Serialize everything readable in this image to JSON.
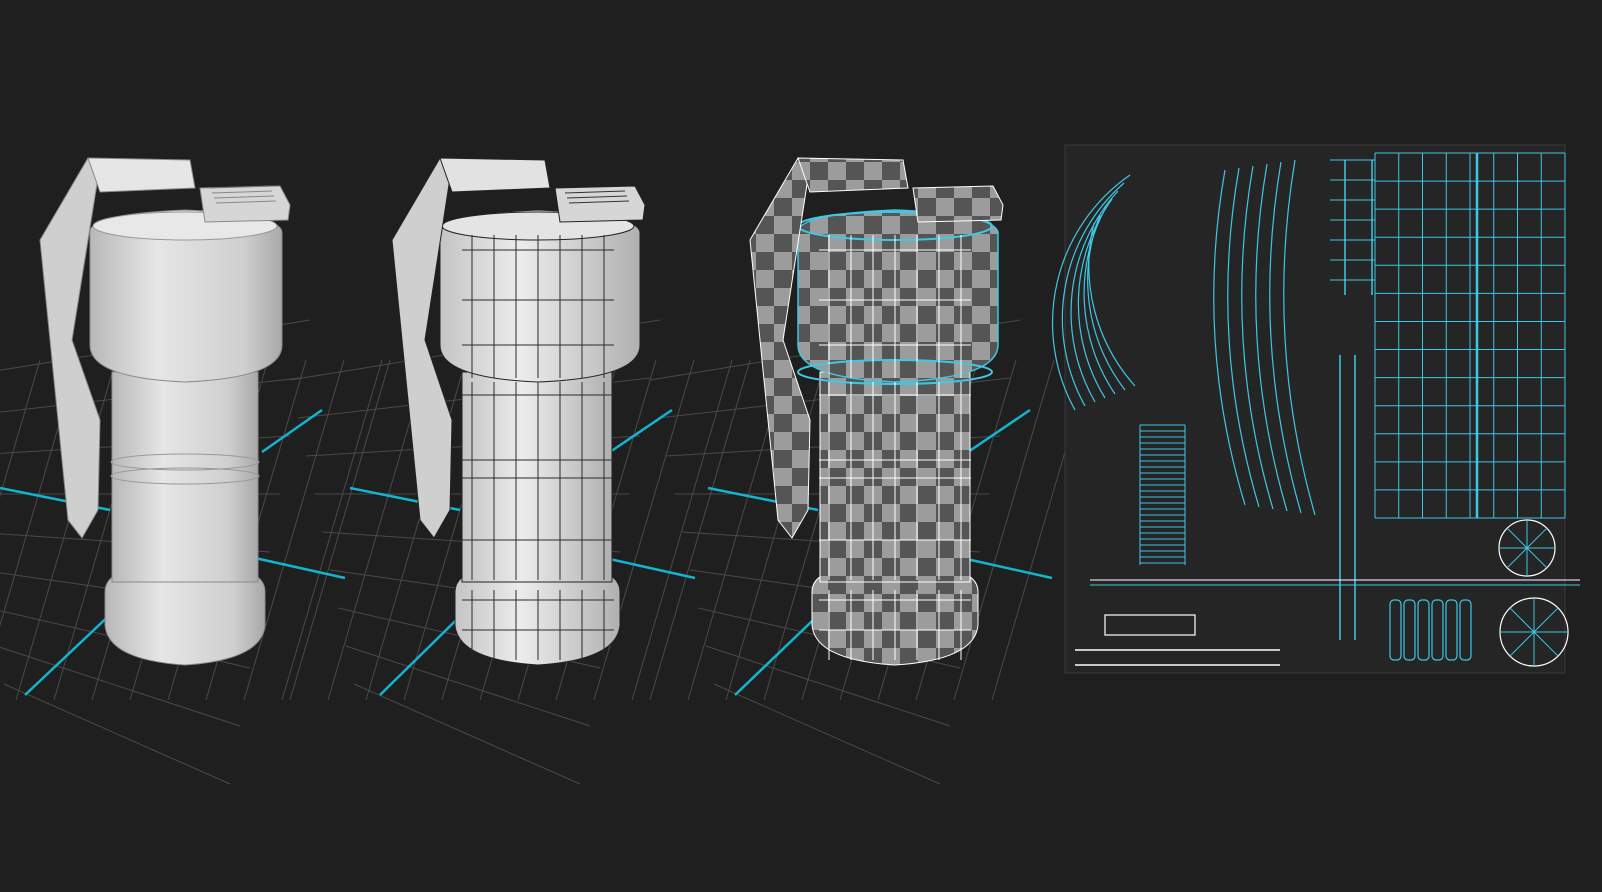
{
  "scene": {
    "background": "#1f1f1f",
    "grid_color": "#4a4a4a",
    "axis_color": "#14b4d0",
    "shaded_color": "#d4d4d4",
    "wire_color": "#2a2a2a",
    "uv_line_color": "#3ec8e4",
    "checker_dark": "#555555",
    "checker_light": "#9c9c9c"
  },
  "panels": [
    {
      "name": "shaded-grenade-model",
      "style": "shaded"
    },
    {
      "name": "wireframe-grenade-model",
      "style": "wireframe"
    },
    {
      "name": "checker-uv-grenade-model",
      "style": "checker"
    },
    {
      "name": "uv-layout-map",
      "style": "uv"
    }
  ]
}
